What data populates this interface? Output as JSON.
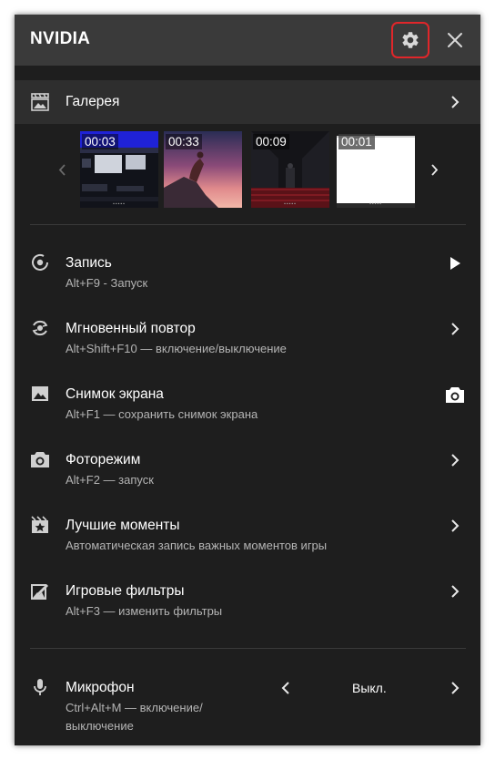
{
  "app": {
    "title": "NVIDIA"
  },
  "gallery": {
    "label": "Галерея",
    "thumbnails": [
      {
        "duration": "00:03"
      },
      {
        "duration": "00:33"
      },
      {
        "duration": "00:09"
      },
      {
        "duration": "00:01"
      }
    ]
  },
  "items": [
    {
      "label": "Запись",
      "hint": "Alt+F9 - Запуск",
      "icon": "record-icon",
      "action_icon": "play-icon"
    },
    {
      "label": "Мгновенный повтор",
      "hint": "Alt+Shift+F10 — включение/выключение",
      "icon": "instant-replay-icon",
      "action_icon": "chevron-right-icon"
    },
    {
      "label": "Снимок экрана",
      "hint": "Alt+F1 — сохранить снимок экрана",
      "icon": "image-icon",
      "action_icon": "camera-icon"
    },
    {
      "label": "Фоторежим",
      "hint": "Alt+F2 — запуск",
      "icon": "camera-icon",
      "action_icon": "chevron-right-icon"
    },
    {
      "label": "Лучшие моменты",
      "hint": "Автоматическая запись важных моментов игры",
      "icon": "highlights-icon",
      "action_icon": "chevron-right-icon"
    },
    {
      "label": "Игровые фильтры",
      "hint": "Alt+F3 — изменить фильтры",
      "icon": "filters-icon",
      "action_icon": "chevron-right-icon"
    }
  ],
  "microphone": {
    "label": "Микрофон",
    "hint_line1": "Ctrl+Alt+M — включение/",
    "hint_line2": "выключение",
    "value": "Выкл."
  },
  "colors": {
    "panel": "#1e1e1e",
    "topbar": "#3a3a3a",
    "highlight": "#e0262a"
  }
}
